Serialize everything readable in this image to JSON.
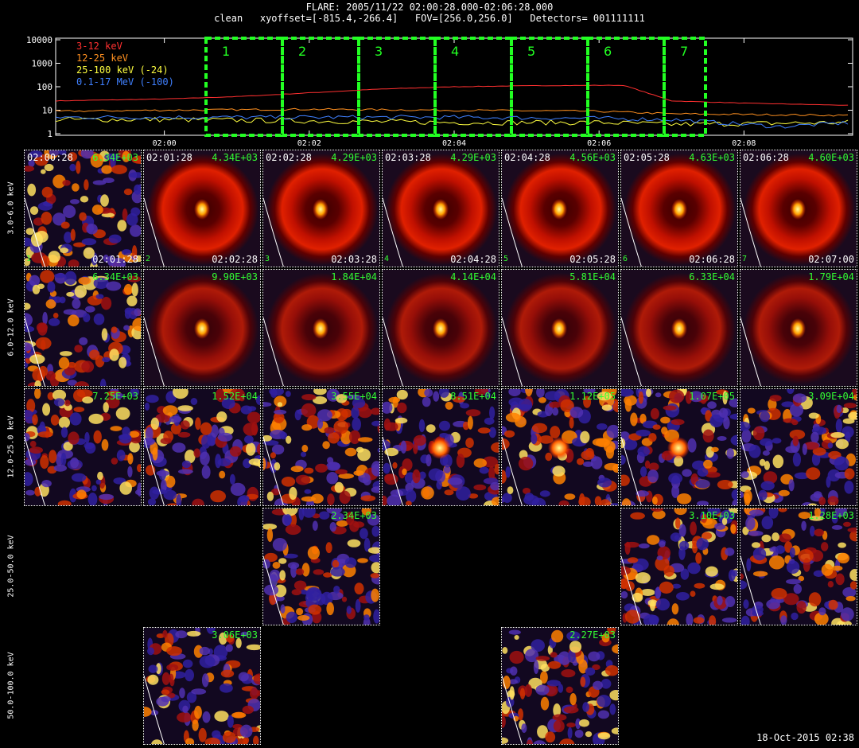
{
  "header": {
    "line1": "FLARE: 2005/11/22 02:00:28.000-02:06:28.000",
    "line2": "clean   xyoffset=[-815.4,-266.4]   FOV=[256.0,256.0]   Detectors= 001111111"
  },
  "lightcurve": {
    "y_ticks": [
      "10000",
      "1000",
      "100",
      "10",
      "1"
    ],
    "x_ticks": [
      "02:00",
      "02:02",
      "02:04",
      "02:06",
      "02:08"
    ],
    "legend": [
      {
        "label": "3-12 keV",
        "color": "#ff3030"
      },
      {
        "label": "12-25 keV",
        "color": "#ff9020"
      },
      {
        "label": "25-100 keV (-24)",
        "color": "#ffff40"
      },
      {
        "label": "0.1-17 MeV (-100)",
        "color": "#4080ff"
      }
    ],
    "intervals": [
      "1",
      "2",
      "3",
      "4",
      "5",
      "6",
      "7"
    ],
    "interval_color": "#22ff22"
  },
  "chart_data": {
    "type": "line",
    "y_scale": "log",
    "ylim": [
      1,
      10000
    ],
    "x_range": [
      "01:58:30",
      "02:09:30"
    ],
    "series": [
      {
        "name": "3-12 keV",
        "x": [
          "01:58:30",
          "02:00:00",
          "02:01:00",
          "02:02:00",
          "02:03:00",
          "02:04:00",
          "02:05:00",
          "02:06:00",
          "02:06:20",
          "02:06:30",
          "02:07:00",
          "02:08:00",
          "02:09:30"
        ],
        "values": [
          25,
          30,
          38,
          55,
          80,
          100,
          110,
          115,
          115,
          80,
          25,
          20,
          16
        ]
      },
      {
        "name": "12-25 keV",
        "x": [
          "01:58:30",
          "02:00:00",
          "02:02:00",
          "02:04:00",
          "02:06:00",
          "02:07:00",
          "02:09:30"
        ],
        "values": [
          9,
          10,
          11,
          10,
          9,
          7,
          6
        ]
      },
      {
        "name": "25-100 keV (-24)",
        "x": [
          "01:58:30",
          "02:00:00",
          "02:02:00",
          "02:04:00",
          "02:06:00",
          "02:07:00",
          "02:09:30"
        ],
        "values": [
          4,
          4,
          3.5,
          3,
          3,
          2.5,
          3
        ]
      },
      {
        "name": "0.1-17 MeV (-100)",
        "x": [
          "01:58:30",
          "02:00:00",
          "02:02:00",
          "02:04:00",
          "02:06:00",
          "02:07:00",
          "02:08:30",
          "02:09:30"
        ],
        "values": [
          5,
          5,
          5,
          5,
          4.5,
          4,
          2,
          3
        ]
      }
    ]
  },
  "energy_rows": [
    "3.0-6.0 keV",
    "6.0-12.0 keV",
    "12.0-25.0 keV",
    "25.0-50.0 keV",
    "50.0-100.0 keV"
  ],
  "start_times": [
    "02:00:28",
    "02:01:28",
    "02:02:28",
    "02:03:28",
    "02:04:28",
    "02:05:28",
    "02:06:28"
  ],
  "end_times": [
    "02:01:28",
    "02:02:28",
    "02:03:28",
    "02:04:28",
    "02:05:28",
    "02:06:28",
    "02:07:00"
  ],
  "interval_numbers": [
    "1",
    "2",
    "3",
    "4",
    "5",
    "6",
    "7"
  ],
  "images": {
    "row0": [
      "6.34E+03",
      "4.34E+03",
      "4.29E+03",
      "4.29E+03",
      "4.56E+03",
      "4.63E+03",
      "4.60E+03"
    ],
    "row1": [
      "6.34E+03",
      "9.90E+03",
      "1.84E+04",
      "4.14E+04",
      "5.81E+04",
      "6.33E+04",
      "1.79E+04"
    ],
    "row2": [
      "7.25E+03",
      "1.52E+04",
      "3.55E+04",
      "8.51E+04",
      "1.12E+05",
      "1.07E+05",
      "3.09E+04"
    ],
    "row3": {
      "col2": "2.34E+03",
      "col5": "3.10E+03",
      "col6": "1.28E+03"
    },
    "row4": {
      "col1": "3.06E+03",
      "col4": "2.27E+03"
    }
  },
  "footer": "18-Oct-2015 02:38"
}
